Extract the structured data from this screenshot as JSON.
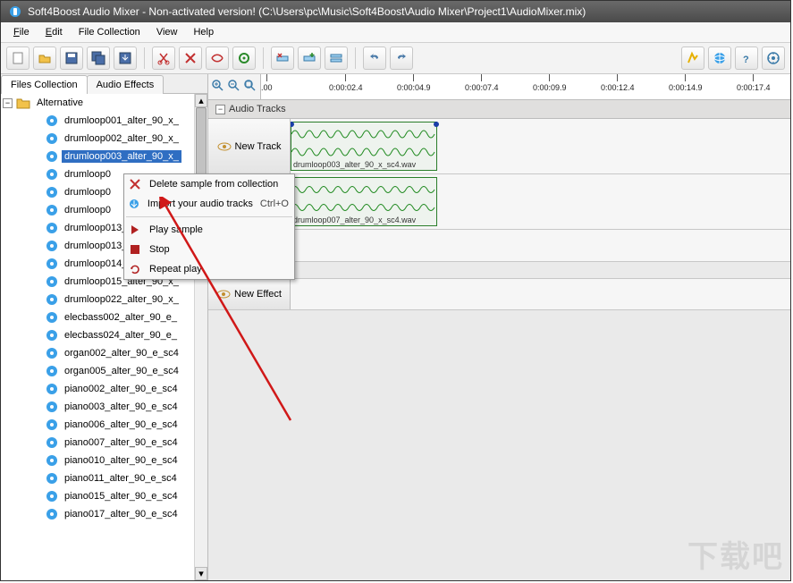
{
  "window": {
    "title": "Soft4Boost Audio Mixer - Non-activated version! (C:\\Users\\pc\\Music\\Soft4Boost\\Audio Mixer\\Project1\\AudioMixer.mix)"
  },
  "menubar": {
    "file": "File",
    "edit": "Edit",
    "file_collection": "File Collection",
    "view": "View",
    "help": "Help"
  },
  "tabs": {
    "files": "Files Collection",
    "effects": "Audio Effects"
  },
  "tree": {
    "folder": "Alternative",
    "items": [
      "drumloop001_alter_90_x_",
      "drumloop002_alter_90_x_",
      "drumloop003_alter_90_x_",
      "drumloop0",
      "drumloop0",
      "drumloop0",
      "drumloop013_alter_90_x_",
      "drumloop013_alter_90_x_",
      "drumloop014_alter_90_x_",
      "drumloop015_alter_90_x_",
      "drumloop022_alter_90_x_",
      "elecbass002_alter_90_e_",
      "elecbass024_alter_90_e_",
      "organ002_alter_90_e_sc4",
      "organ005_alter_90_e_sc4",
      "piano002_alter_90_e_sc4",
      "piano003_alter_90_e_sc4",
      "piano006_alter_90_e_sc4",
      "piano007_alter_90_e_sc4",
      "piano010_alter_90_e_sc4",
      "piano011_alter_90_e_sc4",
      "piano015_alter_90_e_sc4",
      "piano017_alter_90_e_sc4"
    ],
    "selected_index": 2
  },
  "timeline": {
    "ticks": [
      ".00",
      "0:00:02.4",
      "0:00:04.9",
      "0:00:07.4",
      "0:00:09.9",
      "0:00:12.4",
      "0:00:14.9",
      "0:00:17.4"
    ]
  },
  "sections": {
    "audio_tracks": "Audio Tracks",
    "new_track": "New Track",
    "new_effect": "New Effect"
  },
  "clips": [
    {
      "name": "drumloop003_alter_90_x_sc4.wav"
    },
    {
      "name": "drumloop007_alter_90_x_sc4.wav"
    }
  ],
  "contextmenu": {
    "delete": "Delete sample from collection",
    "import": "Import your audio tracks",
    "import_shortcut": "Ctrl+O",
    "play": "Play sample",
    "stop": "Stop",
    "repeat": "Repeat play"
  },
  "watermark": "下载吧"
}
